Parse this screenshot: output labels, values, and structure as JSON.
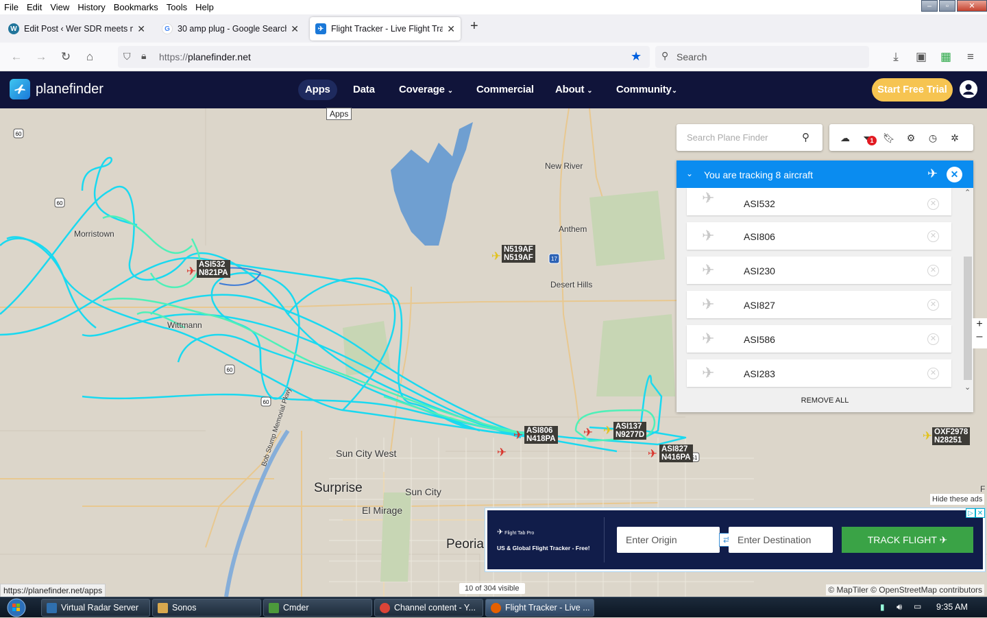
{
  "browser": {
    "menu": [
      "File",
      "Edit",
      "View",
      "History",
      "Bookmarks",
      "Tools",
      "Help"
    ],
    "tabs": [
      {
        "title": "Edit Post ‹ Wer SDR meets micro"
      },
      {
        "title": "30 amp plug - Google Search"
      },
      {
        "title": "Flight Tracker - Live Flight Track"
      }
    ],
    "url_proto": "https://",
    "url_host": "planefinder.net",
    "search_placeholder": "Search"
  },
  "site": {
    "brand": "planefinder",
    "nav": [
      {
        "label": "Apps",
        "active": true
      },
      {
        "label": "Data"
      },
      {
        "label": "Coverage"
      },
      {
        "label": "Commercial"
      },
      {
        "label": "About"
      },
      {
        "label": "Community"
      }
    ],
    "cta": "Start Free Trial",
    "tooltip": "Apps"
  },
  "map": {
    "search_placeholder": "Search Plane Finder",
    "filter_badge": "1",
    "places": [
      "New River",
      "Anthem",
      "Desert Hills",
      "Morristown",
      "Wittmann",
      "Sun City West",
      "Surprise",
      "Sun City",
      "El Mirage",
      "Peoria",
      "Bob Stump Memorial Pkwy"
    ],
    "highway_shields": [
      "60",
      "60",
      "17",
      "60",
      "60",
      "51"
    ],
    "flight_labels": [
      {
        "callsign": "N519AF",
        "reg": "N519AF"
      },
      {
        "callsign": "ASI532",
        "reg": "N821PA"
      },
      {
        "callsign": "ASI806",
        "reg": "N418PA"
      },
      {
        "callsign": "ASI137",
        "reg": "N9277D"
      },
      {
        "callsign": "ASI827",
        "reg": "N416PA"
      },
      {
        "callsign": "OXF2978",
        "reg": "N28251"
      }
    ],
    "visible_count": "10 of 304 visible",
    "attribution": "© MapTiler © OpenStreetMap contributors",
    "hide_ads": "Hide these ads",
    "edge_letter": "F"
  },
  "tracker": {
    "title": "You are tracking 8 aircraft",
    "aircraft": [
      "ASI532",
      "ASI806",
      "ASI230",
      "ASI827",
      "ASI586",
      "ASI283"
    ],
    "remove_all": "REMOVE ALL"
  },
  "ad": {
    "brand": "Flight Tab Pro",
    "tagline": "US & Global Flight Tracker - Free!",
    "origin_placeholder": "Enter Origin",
    "dest_placeholder": "Enter Destination",
    "button": "TRACK FLIGHT"
  },
  "status_url": "https://planefinder.net/apps",
  "taskbar": {
    "items": [
      "Virtual Radar Server",
      "Sonos",
      "Cmder",
      "Channel content - Y...",
      "Flight Tracker - Live ..."
    ],
    "clock": "9:35 AM"
  },
  "colors": {
    "track_cyan": "#1ad9f0",
    "track_green": "#4ef0b8",
    "header": "#10143a",
    "accent": "#0a8cf0",
    "cta": "#f6c451"
  }
}
